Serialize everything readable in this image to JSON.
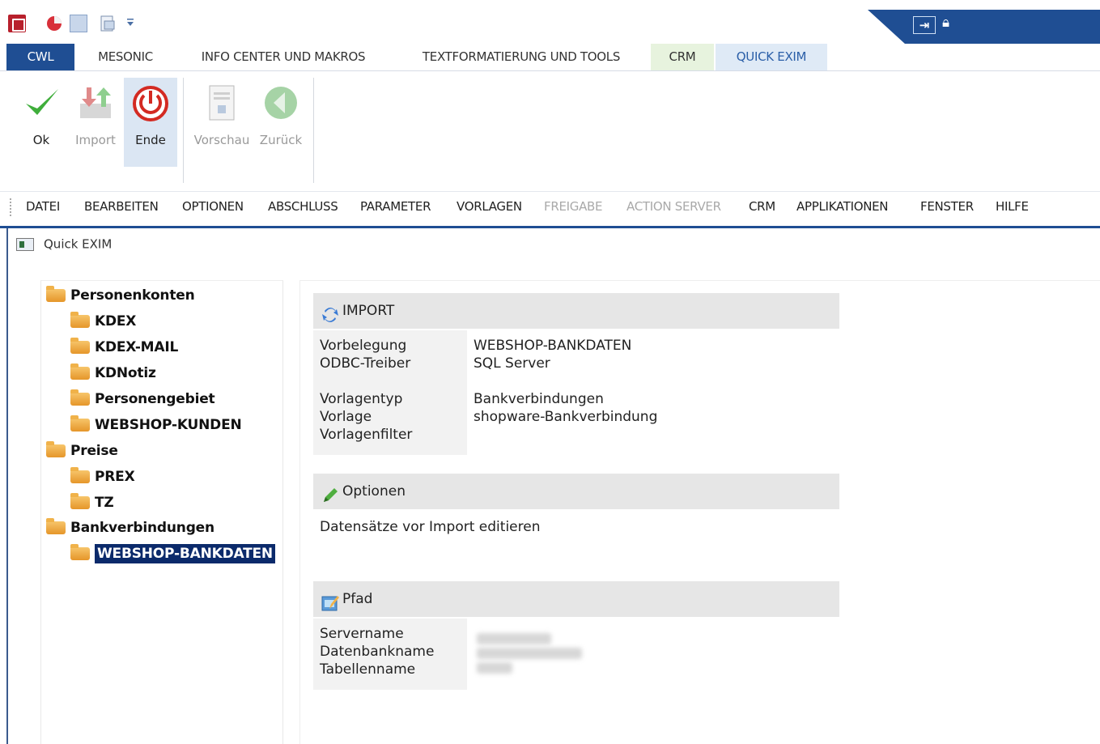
{
  "ribbon_tabs": [
    {
      "label": "CWL"
    },
    {
      "label": "MESONIC"
    },
    {
      "label": "INFO CENTER UND MAKROS"
    },
    {
      "label": "TEXTFORMATIERUNG UND TOOLS"
    },
    {
      "label": "CRM"
    },
    {
      "label": "QUICK EXIM"
    }
  ],
  "ribbon_buttons": {
    "ok": "Ok",
    "import": "Import",
    "ende": "Ende",
    "vorschau": "Vorschau",
    "zurueck": "Zurück"
  },
  "menu": [
    "DATEI",
    "BEARBEITEN",
    "OPTIONEN",
    "ABSCHLUSS",
    "PARAMETER",
    "VORLAGEN",
    "FREIGABE",
    "ACTION SERVER",
    "CRM",
    "APPLIKATIONEN",
    "FENSTER",
    "HILFE"
  ],
  "window_title": "Quick EXIM",
  "tree": [
    {
      "label": "Personenkonten"
    },
    {
      "label": "KDEX"
    },
    {
      "label": "KDEX-MAIL"
    },
    {
      "label": "KDNotiz"
    },
    {
      "label": "Personengebiet"
    },
    {
      "label": "WEBSHOP-KUNDEN"
    },
    {
      "label": "Preise"
    },
    {
      "label": "PREX"
    },
    {
      "label": "TZ"
    },
    {
      "label": "Bankverbindungen"
    },
    {
      "label": "WEBSHOP-BANKDATEN"
    }
  ],
  "import_section": {
    "title": "IMPORT",
    "labels": [
      "Vorbelegung",
      "ODBC-Treiber",
      "Vorlagentyp",
      "Vorlage",
      "Vorlagenfilter"
    ],
    "values": [
      "WEBSHOP-BANKDATEN",
      "SQL Server",
      "Bankverbindungen",
      "shopware-Bankverbindung",
      ""
    ]
  },
  "optionen_section": {
    "title": "Optionen",
    "text": "Datensätze vor Import editieren"
  },
  "pfad_section": {
    "title": "Pfad",
    "labels": [
      "Servername",
      "Datenbankname",
      "Tabellenname"
    ]
  },
  "colors": {
    "accent": "#1f4e93",
    "selection": "#0b2a6b",
    "section_header": "#e6e6e6"
  }
}
